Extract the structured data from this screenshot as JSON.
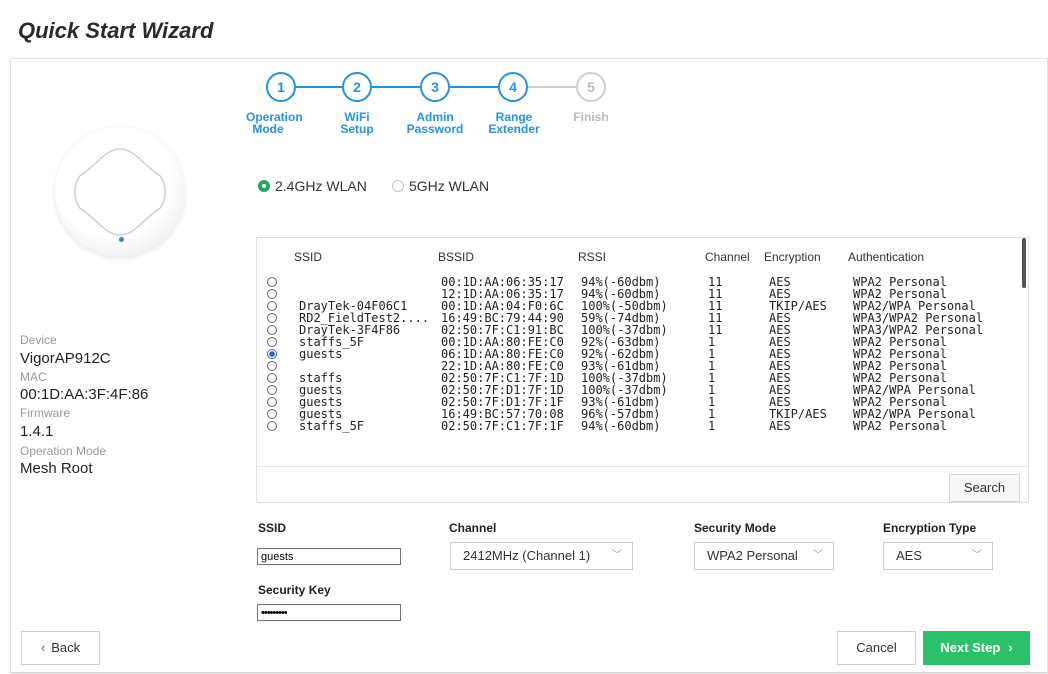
{
  "page_title": "Quick Start Wizard",
  "steps": [
    {
      "num": "1",
      "label_line1": "Operation",
      "label_line2": "Mode",
      "state": "done"
    },
    {
      "num": "2",
      "label_line1": "WiFi",
      "label_line2": "Setup",
      "state": "done"
    },
    {
      "num": "3",
      "label_line1": "Admin",
      "label_line2": "Password",
      "state": "done"
    },
    {
      "num": "4",
      "label_line1": "Range",
      "label_line2": "Extender",
      "state": "active"
    },
    {
      "num": "5",
      "label_line1": "Finish",
      "label_line2": "",
      "state": "pending"
    }
  ],
  "device_info": {
    "device_label": "Device",
    "device_value": "VigorAP912C",
    "mac_label": "MAC",
    "mac_value": "00:1D:AA:3F:4F:86",
    "firmware_label": "Firmware",
    "firmware_value": "1.4.1",
    "opmode_label": "Operation Mode",
    "opmode_value": "Mesh Root"
  },
  "band": {
    "option_24": "2.4GHz WLAN",
    "option_5": "5GHz WLAN",
    "selected": "2.4GHz WLAN"
  },
  "scan_table": {
    "columns": [
      "SSID",
      "BSSID",
      "RSSI",
      "Channel",
      "Encryption",
      "Authentication"
    ],
    "rows": [
      {
        "ssid": "",
        "bssid": "00:1D:AA:06:35:17",
        "rssi": "94%(-60dbm)",
        "channel": "11",
        "encryption": "AES",
        "auth": "WPA2 Personal",
        "selected": false
      },
      {
        "ssid": "",
        "bssid": "12:1D:AA:06:35:17",
        "rssi": "94%(-60dbm)",
        "channel": "11",
        "encryption": "AES",
        "auth": "WPA2 Personal",
        "selected": false
      },
      {
        "ssid": "DrayTek-04F06C1",
        "bssid": "00:1D:AA:04:F0:6C",
        "rssi": "100%(-50dbm)",
        "channel": "11",
        "encryption": "TKIP/AES",
        "auth": "WPA2/WPA Personal",
        "selected": false
      },
      {
        "ssid": "RD2_FieldTest2....",
        "bssid": "16:49:BC:79:44:90",
        "rssi": "59%(-74dbm)",
        "channel": "11",
        "encryption": "AES",
        "auth": "WPA3/WPA2 Personal",
        "selected": false
      },
      {
        "ssid": "DrayTek-3F4F86",
        "bssid": "02:50:7F:C1:91:BC",
        "rssi": "100%(-37dbm)",
        "channel": "11",
        "encryption": "AES",
        "auth": "WPA3/WPA2 Personal",
        "selected": false
      },
      {
        "ssid": "staffs_5F",
        "bssid": "00:1D:AA:80:FE:C0",
        "rssi": "92%(-63dbm)",
        "channel": "1",
        "encryption": "AES",
        "auth": "WPA2 Personal",
        "selected": false
      },
      {
        "ssid": "guests",
        "bssid": "06:1D:AA:80:FE:C0",
        "rssi": "92%(-62dbm)",
        "channel": "1",
        "encryption": "AES",
        "auth": "WPA2 Personal",
        "selected": true
      },
      {
        "ssid": "",
        "bssid": "22:1D:AA:80:FE:C0",
        "rssi": "93%(-61dbm)",
        "channel": "1",
        "encryption": "AES",
        "auth": "WPA2 Personal",
        "selected": false
      },
      {
        "ssid": "staffs",
        "bssid": "02:50:7F:C1:7F:1D",
        "rssi": "100%(-37dbm)",
        "channel": "1",
        "encryption": "AES",
        "auth": "WPA2 Personal",
        "selected": false
      },
      {
        "ssid": "guests",
        "bssid": "02:50:7F:D1:7F:1D",
        "rssi": "100%(-37dbm)",
        "channel": "1",
        "encryption": "AES",
        "auth": "WPA2/WPA Personal",
        "selected": false
      },
      {
        "ssid": "guests",
        "bssid": "02:50:7F:D1:7F:1F",
        "rssi": "93%(-61dbm)",
        "channel": "1",
        "encryption": "AES",
        "auth": "WPA2 Personal",
        "selected": false
      },
      {
        "ssid": "guests",
        "bssid": "16:49:BC:57:70:08",
        "rssi": "96%(-57dbm)",
        "channel": "1",
        "encryption": "TKIP/AES",
        "auth": "WPA2/WPA Personal",
        "selected": false
      },
      {
        "ssid": "staffs_5F",
        "bssid": "02:50:7F:C1:7F:1F",
        "rssi": "94%(-60dbm)",
        "channel": "1",
        "encryption": "AES",
        "auth": "WPA2 Personal",
        "selected": false
      }
    ],
    "search_label": "Search"
  },
  "form": {
    "ssid_label": "SSID",
    "ssid_value": "guests",
    "channel_label": "Channel",
    "channel_value": "2412MHz (Channel 1)",
    "security_mode_label": "Security Mode",
    "security_mode_value": "WPA2 Personal",
    "encryption_label": "Encryption Type",
    "encryption_value": "AES",
    "key_label": "Security Key",
    "key_value": "•••••••••"
  },
  "buttons": {
    "back": "Back",
    "cancel": "Cancel",
    "next": "Next Step"
  },
  "colors": {
    "accent_blue": "#2493e0",
    "accent_green": "#2bc26b",
    "radio_green": "#27a361"
  }
}
